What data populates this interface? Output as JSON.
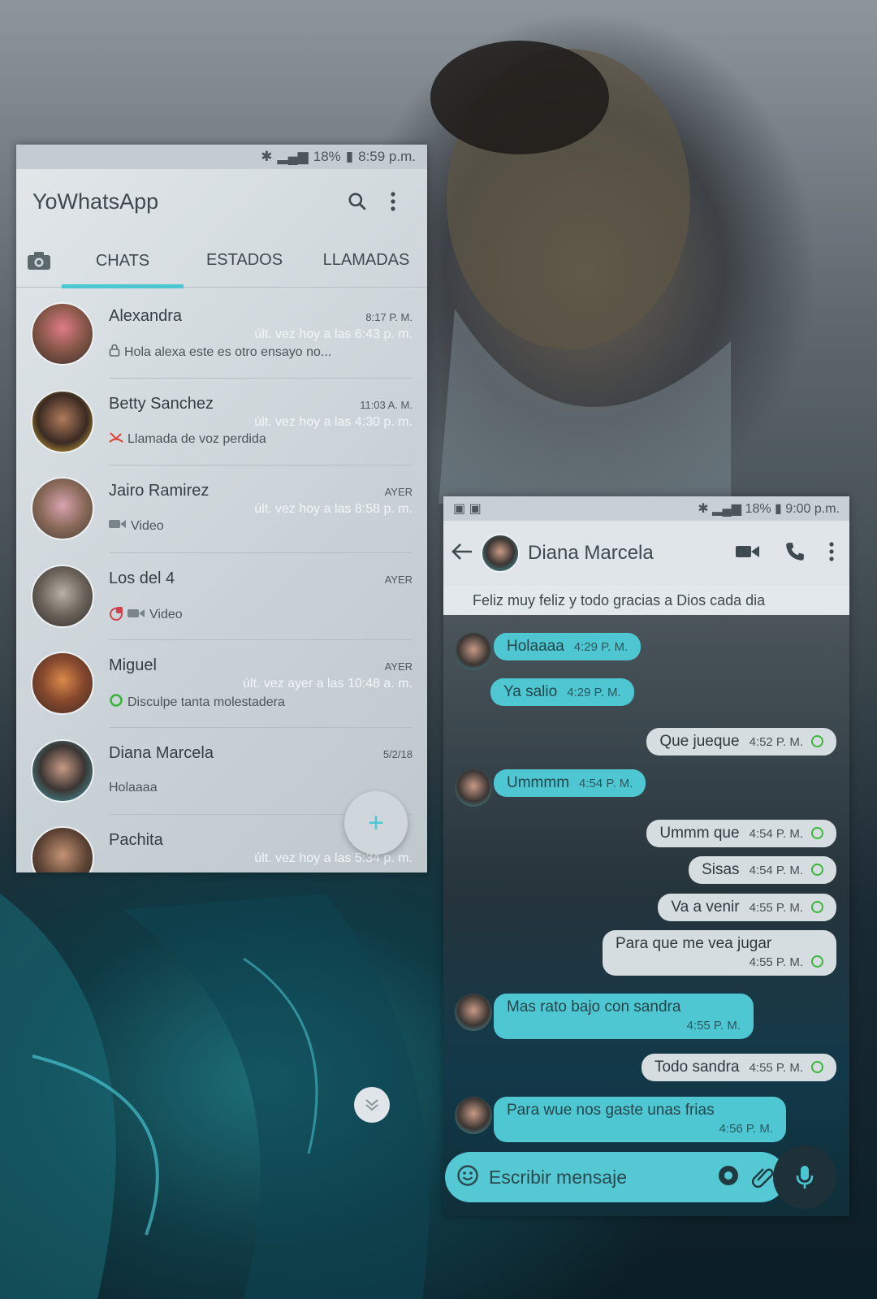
{
  "left": {
    "status": {
      "battery": "18%",
      "time": "8:59 p.m."
    },
    "app_title": "YoWhatsApp",
    "tabs": [
      "CHATS",
      "ESTADOS",
      "LLAMADAS"
    ],
    "chats": [
      {
        "name": "Alexandra",
        "time": "8:17 P. M.",
        "last_seen": "últ. vez hoy a las 6:43 p. m.",
        "preview": "Hola alexa este es otro ensayo no...",
        "icon": "lock-icon"
      },
      {
        "name": "Betty Sanchez",
        "time": "11:03 A. M.",
        "last_seen": "últ. vez hoy a las 4:30 p. m.",
        "preview": "Llamada de voz perdida",
        "icon": "missed-call-icon"
      },
      {
        "name": "Jairo Ramirez",
        "time": "AYER",
        "last_seen": "últ. vez hoy a las 8:58 p. m.",
        "preview": "Video",
        "icon": "video-icon"
      },
      {
        "name": "Los del 4",
        "time": "AYER",
        "last_seen": "",
        "preview": "Video",
        "icon": "video-icon"
      },
      {
        "name": "Miguel",
        "time": "AYER",
        "last_seen": "últ. vez ayer a las 10:48 a. m.",
        "preview": "Disculpe tanta molestadera",
        "icon": "read-tick-icon"
      },
      {
        "name": "Diana Marcela",
        "time": "5/2/18",
        "last_seen": "",
        "preview": "Holaaaa",
        "icon": ""
      },
      {
        "name": "Pachita",
        "time": "",
        "last_seen": "últ. vez hoy a las 5:34 p. m.",
        "preview": "",
        "icon": ""
      }
    ],
    "fab_label": "+"
  },
  "right": {
    "status": {
      "battery": "18%",
      "time": "9:00 p.m."
    },
    "contact_name": "Diana Marcela",
    "motto": "Feliz muy feliz y todo gracias a Dios cada dia",
    "messages": [
      {
        "text": "Holaaaa",
        "time": "4:29 P. M.",
        "dir": "in",
        "avatar": true
      },
      {
        "text": "Ya salio",
        "time": "4:29 P. M.",
        "dir": "in",
        "avatar": false
      },
      {
        "text": "Que jueque",
        "time": "4:52 P. M.",
        "dir": "out"
      },
      {
        "text": "Ummmm",
        "time": "4:54 P. M.",
        "dir": "in",
        "avatar": true
      },
      {
        "text": "Ummm que",
        "time": "4:54 P. M.",
        "dir": "out"
      },
      {
        "text": "Sisas",
        "time": "4:54 P. M.",
        "dir": "out"
      },
      {
        "text": "Va a venir",
        "time": "4:55 P. M.",
        "dir": "out"
      },
      {
        "text": "Para que me vea jugar",
        "time": "4:55 P. M.",
        "dir": "out"
      },
      {
        "text": "Mas rato bajo  con sandra",
        "time": "4:55 P. M.",
        "dir": "in",
        "avatar": true
      },
      {
        "text": "Todo sandra",
        "time": "4:55 P. M.",
        "dir": "out"
      },
      {
        "text": "Para wue nos gaste unas frias",
        "time": "4:56 P. M.",
        "dir": "in",
        "avatar": true
      }
    ],
    "composer_placeholder": "Escribir mensaje"
  }
}
